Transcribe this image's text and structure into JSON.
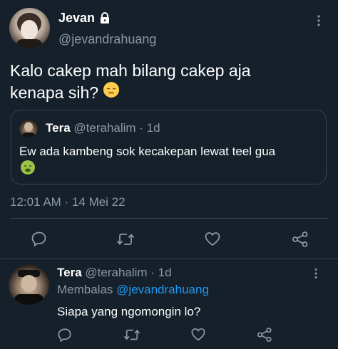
{
  "main_tweet": {
    "author_name": "Jevan",
    "author_handle": "@jevandrahuang",
    "text_line1": "Kalo cakep mah bilang cakep aja",
    "text_line2": "kenapa sih?",
    "timestamp": "12:01 AM · 14 Mei 22"
  },
  "quoted_tweet": {
    "author_name": "Tera",
    "author_meta": "@terahalim · 1d",
    "text": "Ew ada kambeng sok kecakepan lewat teel gua"
  },
  "reply": {
    "author_name": "Tera",
    "author_meta": "@terahalim · 1d",
    "replying_prefix": "Membalas",
    "replying_to": "@jevandrahuang",
    "text": "Siapa yang ngomongin lo?"
  },
  "icons": {
    "lock": "lock-icon",
    "more": "more-options-icon",
    "reply": "reply-icon",
    "retweet": "retweet-icon",
    "like": "like-icon",
    "share": "share-icon"
  },
  "colors": {
    "background": "#15202b",
    "muted": "#8b98a5",
    "link": "#1d9bf0",
    "border": "#38444d"
  }
}
